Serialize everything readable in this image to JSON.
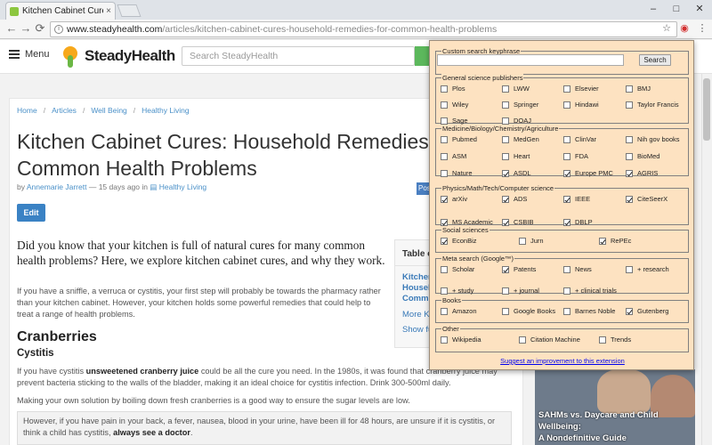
{
  "browser": {
    "tab_title": "Kitchen Cabinet Cures: H",
    "tab_close": "×",
    "url_host": "www.steadyhealth.com",
    "url_path": "/articles/kitchen-cabinet-cures-household-remedies-for-common-health-problems",
    "back_glyph": "←",
    "forward_glyph": "→",
    "reload_glyph": "⟳",
    "win_min": "–",
    "win_max": "□",
    "win_close": "✕",
    "star_glyph": "☆",
    "ext_glyph": "◉",
    "menu_glyph": "⋮"
  },
  "header": {
    "menu_label": "Menu",
    "logo_text": "SteadyHealth",
    "search_placeholder": "Search SteadyHealth"
  },
  "article": {
    "breadcrumb": [
      "Home",
      "Articles",
      "Well Being",
      "Healthy Living"
    ],
    "breadcrumb_sep": "/",
    "title_line1": "Kitchen Cabinet Cures: Household Remedies F",
    "title_line2": "Common Health Problems",
    "by": "by",
    "author": "Annemarie Jarrett",
    "time": "— 15 days ago in",
    "category": "Healthy Living",
    "edit_label": "Edit",
    "post_badge": "Pos",
    "lead": "Did you know that your kitchen is full of natural cures for many common health problems? Here, we explore kitchen cabinet cures, and why they work.",
    "para1": "If you have a sniffle, a verruca or cystitis, your first step will probably be towards the pharmacy rather than your kitchen cabinet. However, your kitchen holds some powerful remedies that could help to treat a range of health problems.",
    "heading_cranberries": "Cranberries",
    "heading_cystitis": "Cystitis",
    "para2_a": "If you have cystitis ",
    "para2_bold": "unsweetened cranberry juice",
    "para2_b": " could be all the cure you need. In the 1980s, it was found that cranberry juice may prevent bacteria sticking to the walls of the bladder, making it an ideal choice for cystitis infection. Drink 300-500ml daily.",
    "para3": "Making your own solution by boiling down fresh cranberries is a good way to ensure the sugar levels are low.",
    "callout_a": "However, if you have pain in your back, a fever, nausea, blood in your urine, have been ill for 48 hours, are unsure if it is cystitis, or think a child has cystitis, ",
    "callout_bold": "always see a doctor",
    "callout_end": "."
  },
  "toc": {
    "title": "Table of",
    "links": [
      "Kitchen",
      "Househ",
      "Comm"
    ],
    "more": "More Ki",
    "show": "Show fu"
  },
  "side_card": {
    "caption_line1": "SAHMs vs. Daycare and Child Wellbeing:",
    "caption_line2": "A Nondefinitive Guide"
  },
  "popup": {
    "keyphrase_legend": "Custom search keyphrase",
    "keyphrase_value": "",
    "search_button": "Search",
    "groups": [
      {
        "legend": "General science publishers",
        "items": [
          {
            "label": "Plos",
            "checked": false
          },
          {
            "label": "LWW",
            "checked": false
          },
          {
            "label": "Elsevier",
            "checked": false
          },
          {
            "label": "BMJ",
            "checked": false
          },
          {
            "label": "Wiley",
            "checked": false
          },
          {
            "label": "Springer",
            "checked": false
          },
          {
            "label": "Hindawi",
            "checked": false
          },
          {
            "label": "Taylor Francis",
            "checked": false
          },
          {
            "label": "Sage",
            "checked": false
          },
          {
            "label": "DOAJ",
            "checked": false
          }
        ]
      },
      {
        "legend": "Medicine/Biology/Chemistry/Agriculture",
        "items": [
          {
            "label": "Pubmed",
            "checked": false
          },
          {
            "label": "MedGen",
            "checked": false
          },
          {
            "label": "ClinVar",
            "checked": false
          },
          {
            "label": "Nih gov books",
            "checked": false
          },
          {
            "label": "ASM",
            "checked": false
          },
          {
            "label": "Heart",
            "checked": false
          },
          {
            "label": "FDA",
            "checked": false
          },
          {
            "label": "BioMed",
            "checked": false
          },
          {
            "label": "Nature",
            "checked": false
          },
          {
            "label": "ASDL",
            "checked": true
          },
          {
            "label": "Europe PMC",
            "checked": true
          },
          {
            "label": "AGRIS",
            "checked": true
          }
        ]
      },
      {
        "legend": "Physics/Math/Tech/Computer science",
        "items": [
          {
            "label": "arXiv",
            "checked": true
          },
          {
            "label": "ADS",
            "checked": true
          },
          {
            "label": "IEEE",
            "checked": true
          },
          {
            "label": "CiteSeerX",
            "checked": true
          },
          {
            "label": "MS Academic",
            "checked": true
          },
          {
            "label": "CSBIB",
            "checked": true
          },
          {
            "label": "DBLP",
            "checked": true
          }
        ]
      },
      {
        "legend": "Social sciences",
        "items": [
          {
            "label": "EconBiz",
            "checked": true
          },
          {
            "label": "Jurn",
            "checked": false
          },
          {
            "label": "RePEc",
            "checked": true
          }
        ]
      },
      {
        "legend": "Meta search (Google™)",
        "items": [
          {
            "label": "Scholar",
            "checked": false
          },
          {
            "label": "Patents",
            "checked": true
          },
          {
            "label": "News",
            "checked": false
          },
          {
            "label": "+ research",
            "checked": false
          },
          {
            "label": "+ study",
            "checked": false
          },
          {
            "label": "+ journal",
            "checked": false
          },
          {
            "label": "+ clinical trials",
            "checked": false
          }
        ]
      },
      {
        "legend": "Books",
        "items": [
          {
            "label": "Amazon",
            "checked": false
          },
          {
            "label": "Google Books",
            "checked": false
          },
          {
            "label": "Barnes Noble",
            "checked": false
          },
          {
            "label": "Gutenberg",
            "checked": true
          }
        ]
      },
      {
        "legend": "Other",
        "items": [
          {
            "label": "Wikipedia",
            "checked": false
          },
          {
            "label": "Citation Machine",
            "checked": false
          },
          {
            "label": "Trends",
            "checked": false
          }
        ]
      }
    ],
    "suggest_link": "Suggest an improvement to this extension"
  }
}
